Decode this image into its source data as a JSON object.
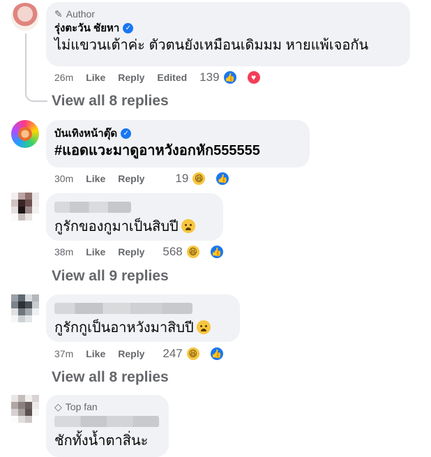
{
  "comments": [
    {
      "badge_label": "Author",
      "name": "รุ่งตะวัน ชัยหา",
      "text": "ไม่แขวนเต้าค่ะ ตัวตนยังเหมือนเดิมมม หายแพ้เจอกัน",
      "time": "26m",
      "like": "Like",
      "reply": "Reply",
      "edited": "Edited",
      "reaction_count": "139",
      "reactions": [
        "like-icon",
        "love-icon"
      ]
    },
    {
      "name": "บันเทิงหน้าตุ๊ด",
      "text": "#แอดแวะมาดูอาหวังอกหัก555555",
      "time": "30m",
      "like": "Like",
      "reply": "Reply",
      "reaction_count": "19",
      "reactions": [
        "haha-icon",
        "like-icon"
      ]
    },
    {
      "text": "กูรักของกูมาเป็นสิบปี",
      "time": "38m",
      "like": "Like",
      "reply": "Reply",
      "reaction_count": "568",
      "reactions": [
        "haha-icon",
        "like-icon"
      ]
    },
    {
      "text": "กูรักกูเป็นอาหวังมาสิบปี",
      "time": "37m",
      "like": "Like",
      "reply": "Reply",
      "reaction_count": "247",
      "reactions": [
        "haha-icon",
        "like-icon"
      ]
    },
    {
      "badge_label": "Top fan",
      "text": "ชักทั้งน้ำตาสิ่นะ"
    }
  ],
  "view_replies": [
    "View all 8 replies",
    "View all 9 replies",
    "View all 8 replies"
  ],
  "colors": {
    "like": "#1877f2",
    "love": "#f33e58",
    "haha": "#f7c640",
    "bubble": "#f0f2f5",
    "muted": "#65676b"
  }
}
